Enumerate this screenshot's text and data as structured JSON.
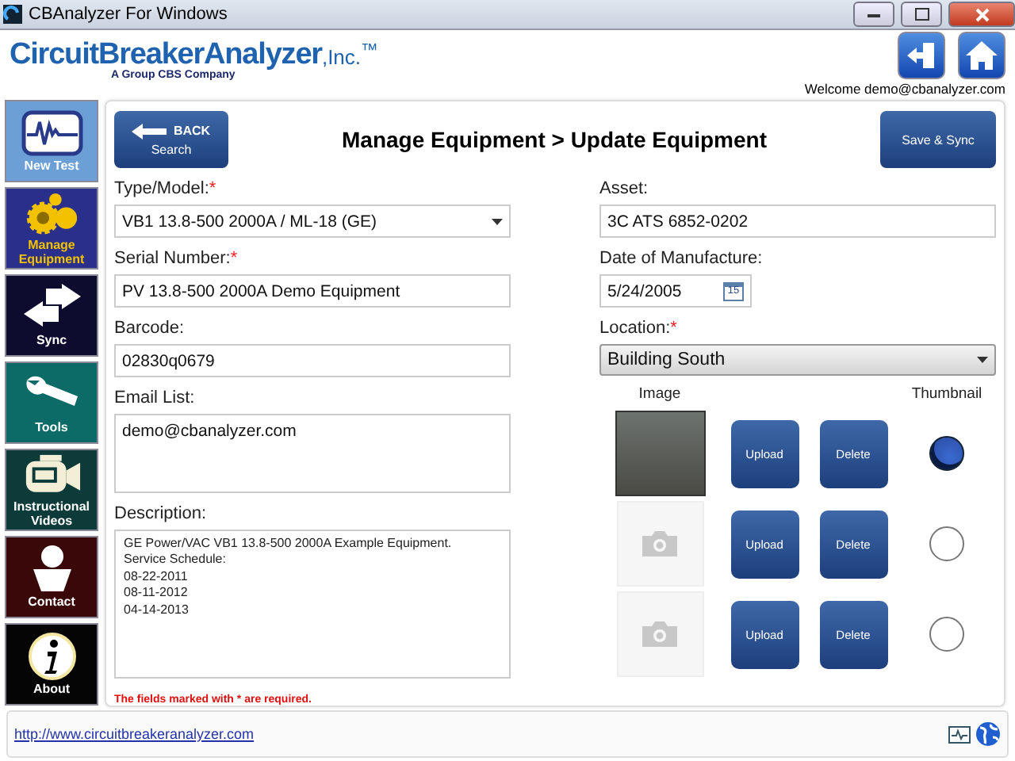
{
  "window": {
    "title": "CBAnalyzer For Windows"
  },
  "header": {
    "logo_title": "CircuitBreakerAnalyzer",
    "logo_suffix": ",Inc.$^{™}$",
    "logo_tagline": "A Group CBS Company",
    "welcome": "Welcome demo@cbanalyzer.com"
  },
  "sidebar": {
    "items": [
      {
        "kind": "new-test",
        "label": "New Test",
        "color": "#6b9fd6",
        "selected": false
      },
      {
        "kind": "manage",
        "label": "Manage Equipment",
        "color": "#2a2f8c",
        "selected": true
      },
      {
        "kind": "sync",
        "label": "Sync",
        "color": "#0d0b2e",
        "selected": false
      },
      {
        "kind": "tools",
        "label": "Tools",
        "color": "#0c6b66",
        "selected": false
      },
      {
        "kind": "videos",
        "label": "Instructional Videos",
        "color": "#0d3b3a",
        "selected": false
      },
      {
        "kind": "contact",
        "label": "Contact",
        "color": "#3a0808",
        "selected": false
      },
      {
        "kind": "about",
        "label": "About",
        "color": "#050505",
        "selected": false
      }
    ]
  },
  "toolbar": {
    "back_label": "BACK",
    "back_sub": "Search",
    "title": "Manage Equipment > Update Equipment",
    "save": "Save & Sync"
  },
  "left_fields": [
    {
      "kind": "select",
      "label": "Type/Model:",
      "required_mark": "*",
      "value": "VB1 13.8-500 2000A / ML-18 (GE)"
    },
    {
      "kind": "text",
      "label": "Serial Number:",
      "required_mark": "*",
      "value": "PV 13.8-500 2000A Demo Equipment"
    },
    {
      "kind": "text",
      "label": "Barcode:",
      "value": "02830q0679"
    },
    {
      "kind": "area",
      "label": "Email List:",
      "value": "demo@cbanalyzer.com"
    }
  ],
  "description": {
    "label": "Description:",
    "lines": [
      "GE Power/VAC VB1 13.8-500 2000A Example Equipment.",
      "Service Schedule:",
      "08-22-2011",
      "08-11-2012",
      "04-14-2013"
    ]
  },
  "note": "The fields marked with * are required.",
  "right_fields": [
    {
      "kind": "text",
      "label": "Asset:",
      "value": "3C ATS 6852-0202"
    },
    {
      "kind": "date",
      "label": "Date of Manufacture:",
      "value": "5/24/2005",
      "calendar_day": "15"
    },
    {
      "kind": "dropdown",
      "label": "Location:",
      "required_mark": "*",
      "value": "Building South"
    }
  ],
  "images": {
    "image_heading": "Image",
    "thumbnail_heading": "Thumbnail",
    "rows": [
      {
        "kind": "photo",
        "upload": "Upload",
        "delete": "Delete",
        "selected": true
      },
      {
        "kind": "empty",
        "upload": "Upload",
        "delete": "Delete",
        "selected": false
      },
      {
        "kind": "empty",
        "upload": "Upload",
        "delete": "Delete",
        "selected": false
      }
    ]
  },
  "footer": {
    "link": "http://www.circuitbreakeranalyzer.com"
  }
}
